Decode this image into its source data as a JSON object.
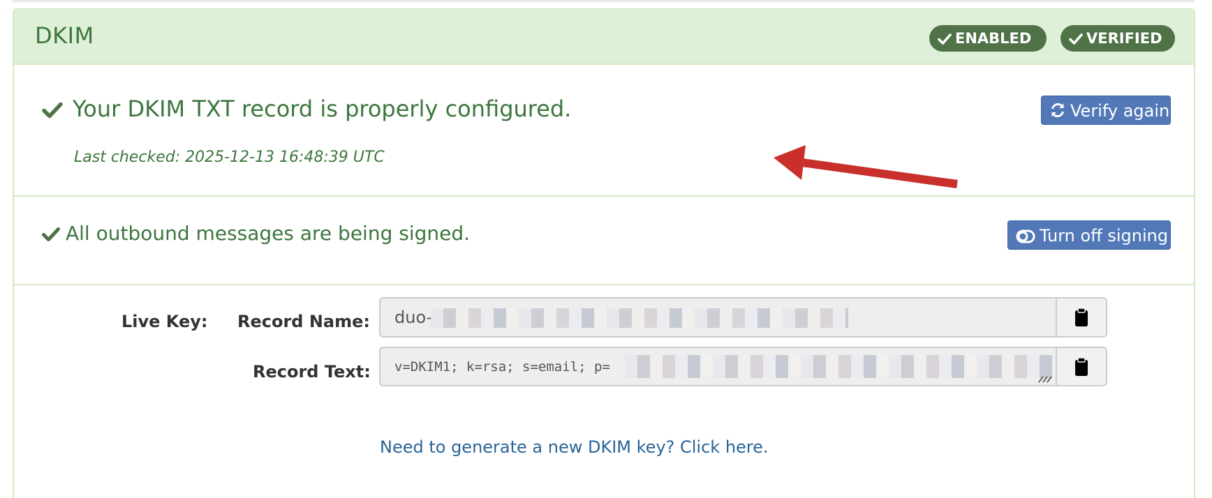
{
  "panel": {
    "title": "DKIM",
    "badges": {
      "enabled": "ENABLED",
      "verified": "VERIFIED"
    }
  },
  "verification": {
    "message": "Your DKIM TXT record is properly configured.",
    "last_checked": "Last checked: 2025-12-13 16:48:39 UTC",
    "verify_button": "Verify again"
  },
  "signing": {
    "message": "All outbound messages are being signed.",
    "toggle_button": "Turn off signing"
  },
  "live_key": {
    "label": "Live Key:",
    "record_name_label": "Record Name:",
    "record_name_value": "duo-",
    "record_text_label": "Record Text:",
    "record_text_value": "v=DKIM1; k=rsa; s=email; p="
  },
  "generate_link": "Need to generate a new DKIM key? Click here.",
  "colors": {
    "success_text": "#3c763d",
    "badge_bg": "#4f7246",
    "primary_button": "#5278b8",
    "link": "#2a6496",
    "annotation_arrow": "#c9302c"
  }
}
